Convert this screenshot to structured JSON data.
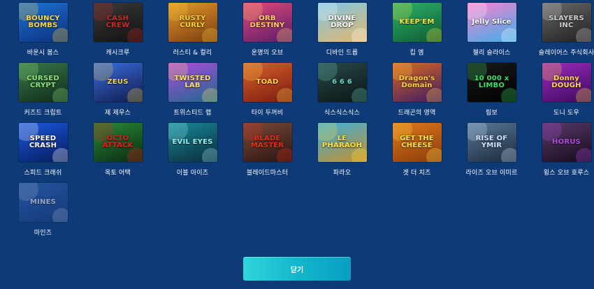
{
  "games": [
    {
      "name": "바운시 봄스",
      "art": "BOUNCY BOMBS",
      "icon": "bouncy-bombs-thumbnail",
      "bg": [
        "#1d74d8",
        "#0b2f7a"
      ],
      "accent": "#ffd640"
    },
    {
      "name": "캐시크루",
      "art": "CASH CREW",
      "icon": "cash-crew-thumbnail",
      "bg": [
        "#3a3a3a",
        "#111111"
      ],
      "accent": "#c42a2a"
    },
    {
      "name": "러스티 & 컬리",
      "art": "RUSTY CURLY",
      "icon": "rusty-curly-thumbnail",
      "bg": [
        "#e59a2a",
        "#7a3a10"
      ],
      "accent": "#f5d23a"
    },
    {
      "name": "운명의 오브",
      "art": "ORB DESTINY",
      "icon": "orb-of-destiny-thumbnail",
      "bg": [
        "#e24a7a",
        "#5a1c6a"
      ],
      "accent": "#ffcc66"
    },
    {
      "name": "디바인 드롭",
      "art": "DIVINE DROP",
      "icon": "divine-drop-thumbnail",
      "bg": [
        "#7ec5e8",
        "#e3b86a"
      ],
      "accent": "#ffffff"
    },
    {
      "name": "킵 엠",
      "art": "KEEP'EM",
      "icon": "keep-em-thumbnail",
      "bg": [
        "#2bb36b",
        "#0f5a30"
      ],
      "accent": "#f2e34a"
    },
    {
      "name": "젤리 슬라이스",
      "art": "Jelly Slice",
      "icon": "jelly-slice-thumbnail",
      "bg": [
        "#ff7fd0",
        "#3ab0e8"
      ],
      "accent": "#ffffff"
    },
    {
      "name": "슬레이어스 주식회사",
      "art": "SLAYERS INC",
      "icon": "slayers-inc-thumbnail",
      "bg": [
        "#6b6b6b",
        "#1e1e1e"
      ],
      "accent": "#cfcfcf"
    },
    {
      "name": "커즈드 크립트",
      "art": "CURSED CRYPT",
      "icon": "cursed-crypt-thumbnail",
      "bg": [
        "#3a7a4a",
        "#0f2a1a"
      ],
      "accent": "#8fe07a"
    },
    {
      "name": "제 제우스",
      "art": "ZEUS",
      "icon": "zeus-thumbnail",
      "bg": [
        "#3a6ee0",
        "#101a4a"
      ],
      "accent": "#f2d24a"
    },
    {
      "name": "트위스티드 랩",
      "art": "TWISTED LAB",
      "icon": "twisted-lab-thumbnail",
      "bg": [
        "#b04ae0",
        "#1a6a8a"
      ],
      "accent": "#ffe066"
    },
    {
      "name": "타이 두꺼비",
      "art": "TOAD",
      "icon": "tai-toad-thumbnail",
      "bg": [
        "#d9622a",
        "#7a1a10"
      ],
      "accent": "#ffd24a"
    },
    {
      "name": "식스식스식스",
      "art": "6 6 6",
      "icon": "six-six-six-thumbnail",
      "bg": [
        "#2a4a4a",
        "#0a1414"
      ],
      "accent": "#6ad0c0"
    },
    {
      "name": "드래곤의 영역",
      "art": "Dragon's Domain",
      "icon": "dragons-domain-thumbnail",
      "bg": [
        "#e06a1a",
        "#3a1a6a"
      ],
      "accent": "#ffd040"
    },
    {
      "name": "림보",
      "art": "10 000 x LIMBO",
      "icon": "limbo-thumbnail",
      "bg": [
        "#1a1a1a",
        "#000000"
      ],
      "accent": "#3adf6a"
    },
    {
      "name": "도니 도우",
      "art": "Donny DOUGH",
      "icon": "donny-dough-thumbnail",
      "bg": [
        "#a02ac0",
        "#3a0a5a"
      ],
      "accent": "#ffdd44"
    },
    {
      "name": "스피드 크래쉬",
      "art": "SPEED CRASH",
      "icon": "speed-crash-thumbnail",
      "bg": [
        "#1a5ae0",
        "#061a5a"
      ],
      "accent": "#ffffff"
    },
    {
      "name": "옥토 어택",
      "art": "OCTO ATTACK",
      "icon": "octo-attack-thumbnail",
      "bg": [
        "#2a8a3a",
        "#0a2a10"
      ],
      "accent": "#e0201a"
    },
    {
      "name": "이블 아이즈",
      "art": "EVIL EYES",
      "icon": "evil-eyes-thumbnail",
      "bg": [
        "#1a8a9a",
        "#0a2a3a"
      ],
      "accent": "#9af0f0"
    },
    {
      "name": "블레이드마스터",
      "art": "BLADE MASTER",
      "icon": "blade-master-thumbnail",
      "bg": [
        "#7a4a3a",
        "#2a1410"
      ],
      "accent": "#e0301a"
    },
    {
      "name": "파라오",
      "art": "LE PHARAOH",
      "icon": "le-pharaoh-thumbnail",
      "bg": [
        "#3ab0e0",
        "#c8902a"
      ],
      "accent": "#ffe040"
    },
    {
      "name": "겟 더 치즈",
      "art": "GET THE CHEESE",
      "icon": "get-the-cheese-thumbnail",
      "bg": [
        "#e07a1a",
        "#8a3a0a"
      ],
      "accent": "#ffe04a"
    },
    {
      "name": "라이즈 오브 이미르",
      "art": "RISE OF YMIR",
      "icon": "rise-of-ymir-thumbnail",
      "bg": [
        "#5a7a9a",
        "#1a2a3a"
      ],
      "accent": "#cfe4ff"
    },
    {
      "name": "윙스 오브 호루스",
      "art": "HORUS",
      "icon": "wings-of-horus-thumbnail",
      "bg": [
        "#5a3a6a",
        "#140a1a"
      ],
      "accent": "#b04ae0"
    },
    {
      "name": "마인즈",
      "art": "MINES",
      "icon": "mines-thumbnail",
      "bg": [
        "#3a6ac0",
        "#1a3a7a"
      ],
      "accent": "#ffffff",
      "faded": true
    }
  ],
  "close_button": {
    "label": "닫기"
  }
}
